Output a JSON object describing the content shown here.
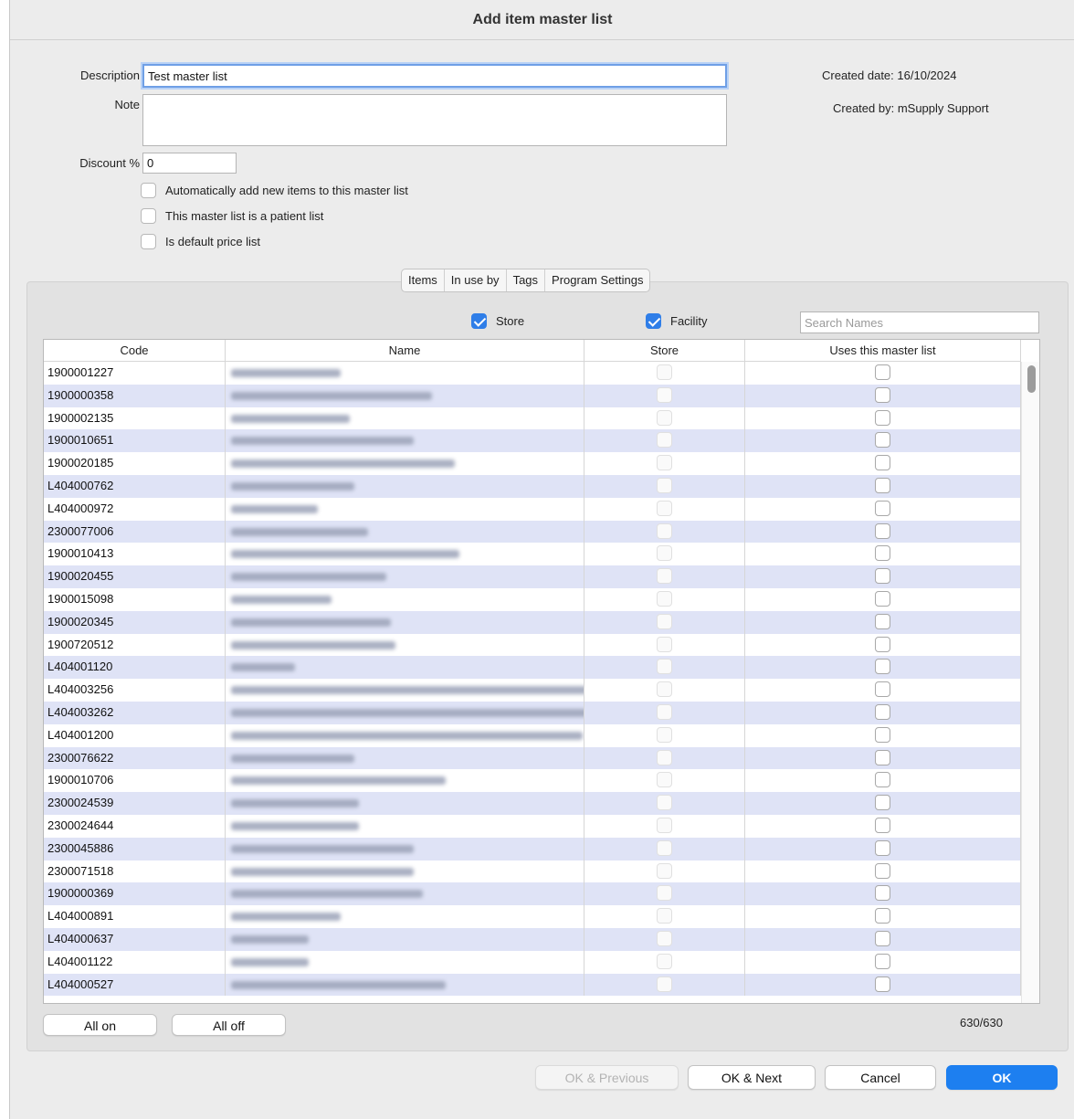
{
  "window": {
    "title": "Add item master list"
  },
  "form": {
    "description_label": "Description",
    "description_value": "Test master list",
    "note_label": "Note",
    "note_value": "",
    "discount_label": "Discount %",
    "discount_value": "0",
    "created_date_label": "Created date:",
    "created_date_value": "16/10/2024",
    "created_by_label": "Created by:",
    "created_by_value": "mSupply Support",
    "checkboxes": [
      {
        "label": "Automatically add new items to this master list",
        "checked": false
      },
      {
        "label": "This master list is a patient list",
        "checked": false
      },
      {
        "label": "Is default price list",
        "checked": false
      }
    ]
  },
  "tabs": [
    {
      "label": "Items"
    },
    {
      "label": "In use by"
    },
    {
      "label": "Tags"
    },
    {
      "label": "Program Settings"
    }
  ],
  "filters": {
    "store_label": "Store",
    "store_checked": true,
    "facility_label": "Facility",
    "facility_checked": true,
    "search_placeholder": "Search Names"
  },
  "table": {
    "columns": [
      "Code",
      "Name",
      "Store",
      "Uses this master list"
    ],
    "rows": [
      {
        "code": "1900001227",
        "name_redacted": true,
        "store": false,
        "uses": false
      },
      {
        "code": "1900000358",
        "name_redacted": true,
        "store": false,
        "uses": false
      },
      {
        "code": "1900002135",
        "name_redacted": true,
        "store": false,
        "uses": false
      },
      {
        "code": "1900010651",
        "name_redacted": true,
        "store": false,
        "uses": false
      },
      {
        "code": "1900020185",
        "name_redacted": true,
        "store": false,
        "uses": false
      },
      {
        "code": "L404000762",
        "name_redacted": true,
        "store": false,
        "uses": false
      },
      {
        "code": "L404000972",
        "name_redacted": true,
        "store": false,
        "uses": false
      },
      {
        "code": "2300077006",
        "name_redacted": true,
        "store": false,
        "uses": false
      },
      {
        "code": "1900010413",
        "name_redacted": true,
        "store": false,
        "uses": false
      },
      {
        "code": "1900020455",
        "name_redacted": true,
        "store": false,
        "uses": false
      },
      {
        "code": "1900015098",
        "name_redacted": true,
        "store": false,
        "uses": false
      },
      {
        "code": "1900020345",
        "name_redacted": true,
        "store": false,
        "uses": false
      },
      {
        "code": "1900720512",
        "name_redacted": true,
        "store": false,
        "uses": false
      },
      {
        "code": "L404001120",
        "name_redacted": true,
        "store": false,
        "uses": false
      },
      {
        "code": "L404003256",
        "name_redacted": true,
        "store": false,
        "uses": false
      },
      {
        "code": "L404003262",
        "name_redacted": true,
        "store": false,
        "uses": false
      },
      {
        "code": "L404001200",
        "name_redacted": true,
        "store": false,
        "uses": false
      },
      {
        "code": "2300076622",
        "name_redacted": true,
        "store": false,
        "uses": false
      },
      {
        "code": "1900010706",
        "name_redacted": true,
        "store": false,
        "uses": false
      },
      {
        "code": "2300024539",
        "name_redacted": true,
        "store": false,
        "uses": false
      },
      {
        "code": "2300024644",
        "name_redacted": true,
        "store": false,
        "uses": false
      },
      {
        "code": "2300045886",
        "name_redacted": true,
        "store": false,
        "uses": false
      },
      {
        "code": "2300071518",
        "name_redacted": true,
        "store": false,
        "uses": false
      },
      {
        "code": "1900000369",
        "name_redacted": true,
        "store": false,
        "uses": false
      },
      {
        "code": "L404000891",
        "name_redacted": true,
        "store": false,
        "uses": false
      },
      {
        "code": "L404000637",
        "name_redacted": true,
        "store": false,
        "uses": false
      },
      {
        "code": "L404001122",
        "name_redacted": true,
        "store": false,
        "uses": false
      },
      {
        "code": "L404000527",
        "name_redacted": true,
        "store": false,
        "uses": false
      }
    ]
  },
  "list_buttons": {
    "all_on": "All on",
    "all_off": "All off"
  },
  "count": "630/630",
  "footer": {
    "ok_previous": "OK & Previous",
    "ok_next": "OK & Next",
    "cancel": "Cancel",
    "ok": "OK"
  },
  "colors": {
    "accent": "#1d7ff0",
    "row_alt": "#dfe3f6",
    "background": "#ececec"
  }
}
